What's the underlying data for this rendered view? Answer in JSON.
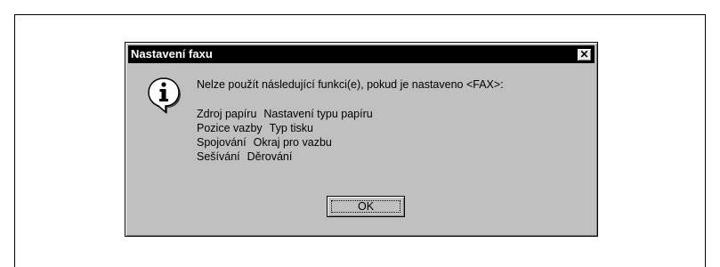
{
  "dialog": {
    "title": "Nastavení faxu",
    "close_label": "✕",
    "message": "Nelze použít následující funkci(e), pokud je nastaveno <FAX>:",
    "functions": [
      {
        "a": "Zdroj papíru",
        "b": "Nastavení typu papíru"
      },
      {
        "a": "Pozice vazby",
        "b": "Typ tisku"
      },
      {
        "a": "Spojování",
        "b": "Okraj pro vazbu"
      },
      {
        "a": "Sešívání",
        "b": "Děrování"
      }
    ],
    "ok_label": "OK",
    "icon": "info-icon"
  }
}
